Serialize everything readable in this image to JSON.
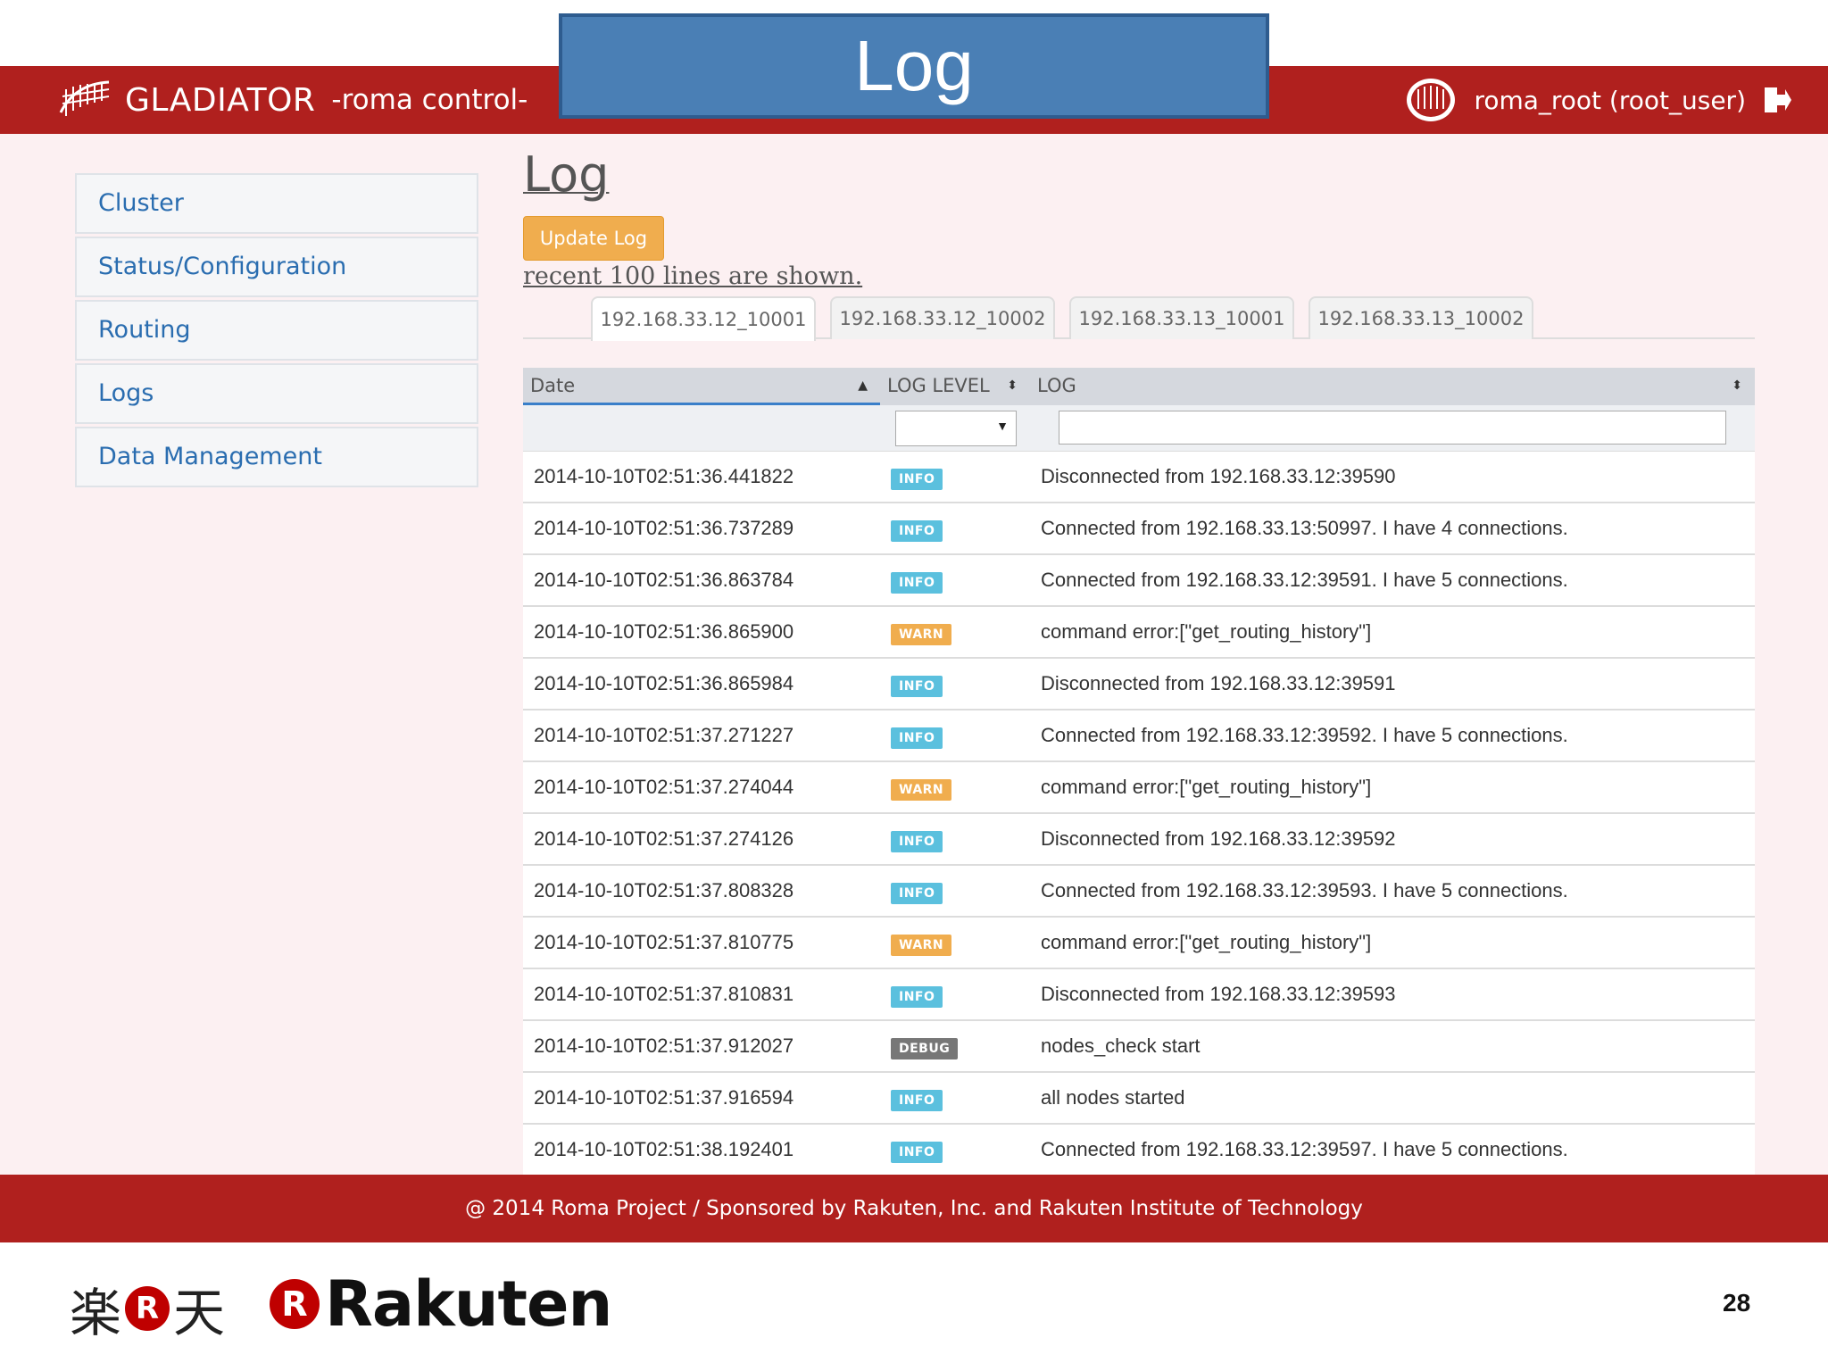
{
  "header": {
    "brand_name": "GLADIATOR",
    "brand_sub": "-roma control-",
    "user_name": "roma_root (root_user)"
  },
  "overlay_title": "Log",
  "sidebar": {
    "items": [
      {
        "label": "Cluster"
      },
      {
        "label": "Status/Configuration"
      },
      {
        "label": "Routing"
      },
      {
        "label": "Logs"
      },
      {
        "label": "Data Management"
      }
    ]
  },
  "main": {
    "title": "Log",
    "update_button": "Update Log",
    "recent_text": "recent 100 lines are shown.",
    "tabs": [
      {
        "label": "192.168.33.12_10001"
      },
      {
        "label": "192.168.33.12_10002"
      },
      {
        "label": "192.168.33.13_10001"
      },
      {
        "label": "192.168.33.13_10002"
      }
    ],
    "active_tab": "192.168.33.12_10001"
  },
  "table": {
    "columns": [
      "Date",
      "LOG LEVEL",
      "LOG"
    ],
    "rows": [
      {
        "date": "2014-10-10T02:51:36.441822",
        "level": "INFO",
        "log": "Disconnected from 192.168.33.12:39590"
      },
      {
        "date": "2014-10-10T02:51:36.737289",
        "level": "INFO",
        "log": "Connected from 192.168.33.13:50997. I have 4 connections."
      },
      {
        "date": "2014-10-10T02:51:36.863784",
        "level": "INFO",
        "log": "Connected from 192.168.33.12:39591. I have 5 connections."
      },
      {
        "date": "2014-10-10T02:51:36.865900",
        "level": "WARN",
        "log": "command error:[\"get_routing_history\"]"
      },
      {
        "date": "2014-10-10T02:51:36.865984",
        "level": "INFO",
        "log": "Disconnected from 192.168.33.12:39591"
      },
      {
        "date": "2014-10-10T02:51:37.271227",
        "level": "INFO",
        "log": "Connected from 192.168.33.12:39592. I have 5 connections."
      },
      {
        "date": "2014-10-10T02:51:37.274044",
        "level": "WARN",
        "log": "command error:[\"get_routing_history\"]"
      },
      {
        "date": "2014-10-10T02:51:37.274126",
        "level": "INFO",
        "log": "Disconnected from 192.168.33.12:39592"
      },
      {
        "date": "2014-10-10T02:51:37.808328",
        "level": "INFO",
        "log": "Connected from 192.168.33.12:39593. I have 5 connections."
      },
      {
        "date": "2014-10-10T02:51:37.810775",
        "level": "WARN",
        "log": "command error:[\"get_routing_history\"]"
      },
      {
        "date": "2014-10-10T02:51:37.810831",
        "level": "INFO",
        "log": "Disconnected from 192.168.33.12:39593"
      },
      {
        "date": "2014-10-10T02:51:37.912027",
        "level": "DEBUG",
        "log": "nodes_check start"
      },
      {
        "date": "2014-10-10T02:51:37.916594",
        "level": "INFO",
        "log": "all nodes started"
      },
      {
        "date": "2014-10-10T02:51:38.192401",
        "level": "INFO",
        "log": "Connected from 192.168.33.12:39597. I have 5 connections."
      }
    ]
  },
  "footer": {
    "text": "@ 2014 Roma Project / Sponsored by Rakuten, Inc. and Rakuten Institute of Technology"
  },
  "slide": {
    "kanji_1": "楽",
    "kanji_r": "R",
    "kanji_2": "天",
    "logo_r": "R",
    "logo_word": "Rakuten",
    "page_number": "28"
  },
  "colors": {
    "brand_red": "#b0201e",
    "title_blue": "#4a7fb5",
    "link_blue": "#2a6db0",
    "info": "#5bc0de",
    "warn": "#f0ad4e",
    "debug": "#777777"
  }
}
